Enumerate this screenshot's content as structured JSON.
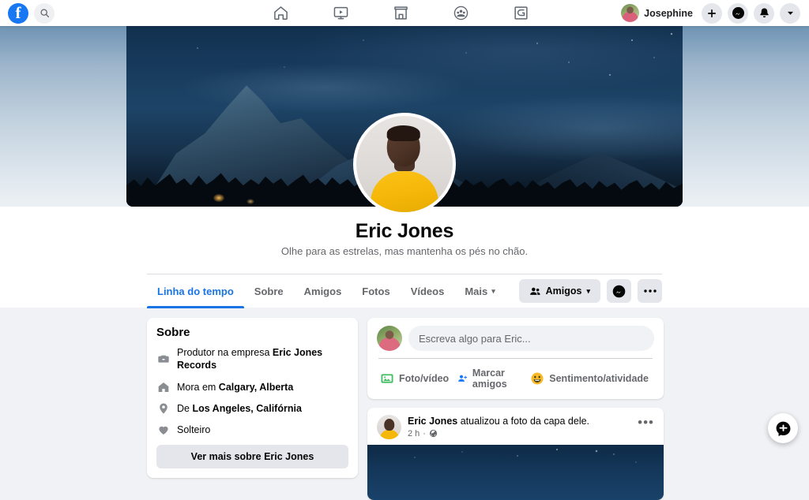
{
  "header": {
    "logo_icon": "facebook-logo",
    "search_icon": "search-icon",
    "nav": [
      {
        "icon": "home-icon",
        "label": "Início"
      },
      {
        "icon": "watch-video-icon",
        "label": "Vídeo"
      },
      {
        "icon": "marketplace-shop-icon",
        "label": "Marketplace"
      },
      {
        "icon": "groups-icon",
        "label": "Grupos"
      },
      {
        "icon": "gaming-icon",
        "label": "Jogos"
      }
    ],
    "account_name": "Josephine",
    "account_avatar_icon": "user-avatar",
    "create_icon": "plus-icon",
    "messenger_icon": "messenger-icon",
    "notifications_icon": "bell-icon",
    "account_menu_icon": "chevron-down-icon"
  },
  "profile": {
    "name": "Eric Jones",
    "bio": "Olhe para as estrelas, mas mantenha os pés no chão.",
    "cover_photo_alt": "night-mountain-cover-photo",
    "profile_photo_alt": "eric-jones-profile-photo"
  },
  "tabs": [
    {
      "label": "Linha do tempo",
      "active": true
    },
    {
      "label": "Sobre",
      "active": false
    },
    {
      "label": "Amigos",
      "active": false
    },
    {
      "label": "Fotos",
      "active": false
    },
    {
      "label": "Vídeos",
      "active": false
    },
    {
      "label": "Mais",
      "active": false,
      "caret": "▾"
    }
  ],
  "profile_actions": {
    "friends_label": "Amigos",
    "friends_icon": "friends-icon",
    "friends_caret": "▾",
    "message_icon": "messenger-icon",
    "more_icon": "ellipsis-icon"
  },
  "about_card": {
    "title": "Sobre",
    "rows": [
      {
        "icon": "briefcase-icon",
        "prefix": "Produtor na empresa ",
        "strong": "Eric Jones Records",
        "suffix": ""
      },
      {
        "icon": "home-icon",
        "prefix": "Mora em ",
        "strong": "Calgary, Alberta",
        "suffix": ""
      },
      {
        "icon": "location-pin-icon",
        "prefix": "De ",
        "strong": "Los Angeles, Califórnia",
        "suffix": ""
      },
      {
        "icon": "heart-icon",
        "prefix": "Solteiro",
        "strong": "",
        "suffix": ""
      }
    ],
    "see_more_label": "Ver mais sobre Eric Jones"
  },
  "composer": {
    "avatar_icon": "user-avatar",
    "placeholder": "Escreva algo para Eric...",
    "actions": [
      {
        "label": "Foto/vídeo",
        "icon": "photo-video-icon",
        "color": "#45bd62"
      },
      {
        "label": "Marcar amigos",
        "icon": "tag-friends-icon",
        "color": "#1877f2"
      },
      {
        "label": "Sentimento/atividade",
        "icon": "feeling-activity-icon",
        "color": "#f7b928"
      }
    ]
  },
  "post": {
    "author": "Eric Jones",
    "action_text": " atualizou a foto da capa dele.",
    "time": "2 h",
    "separator": "·",
    "privacy_icon": "globe-icon",
    "more_icon": "ellipsis-icon",
    "image_alt": "cover-photo-night-sky"
  },
  "fab": {
    "icon": "new-message-icon"
  },
  "colors": {
    "brand_blue": "#1877f2",
    "active_tab": "#1b74e4",
    "page_bg": "#f0f2f5",
    "card_bg": "#ffffff",
    "muted_text": "#65676b",
    "primary_text": "#050505",
    "grey_button": "#e4e6eb"
  }
}
